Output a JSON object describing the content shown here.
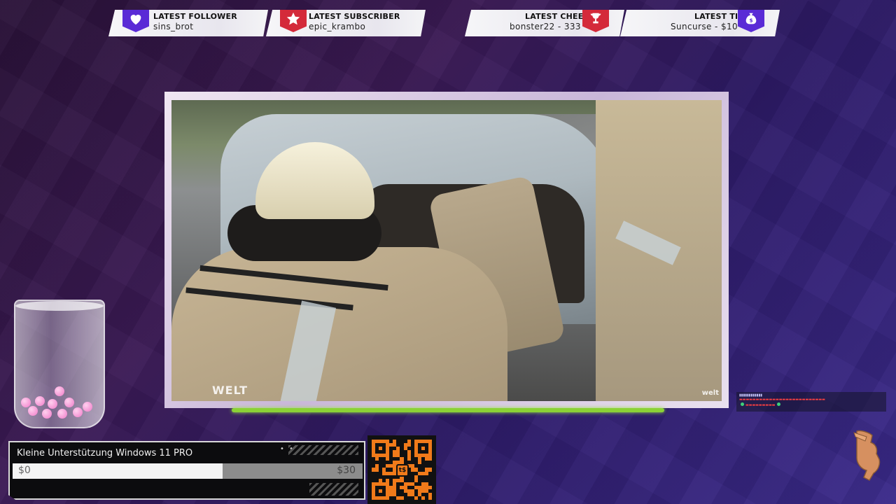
{
  "alerts": [
    {
      "title": "LATEST FOLLOWER",
      "value": "sins_brot",
      "icon": "heart-icon",
      "color": "#5a2bd6"
    },
    {
      "title": "LATEST SUBSCRIBER",
      "value": "epic_krambo",
      "icon": "star-icon",
      "color": "#d42a3a"
    },
    {
      "title": "LATEST CHEER",
      "value": "bonster22 - 333",
      "icon": "trophy-icon",
      "color": "#d42a3a"
    },
    {
      "title": "LATEST TIP",
      "value": "Suncurse - $10",
      "icon": "money-bag-icon",
      "color": "#5a2bd6"
    }
  ],
  "video": {
    "watermark": "WELT",
    "watermark_small": "welt"
  },
  "goal": {
    "title": "Kleine Unterstützung Windows 11 PRO",
    "start_label": "$0",
    "end_label": "$30",
    "progress": 0.6
  },
  "qr": {
    "center_label": "t$",
    "color": "#f07a1a"
  },
  "colors": {
    "accent_green": "#8bd236",
    "jar_ball": "#f07ac8"
  }
}
